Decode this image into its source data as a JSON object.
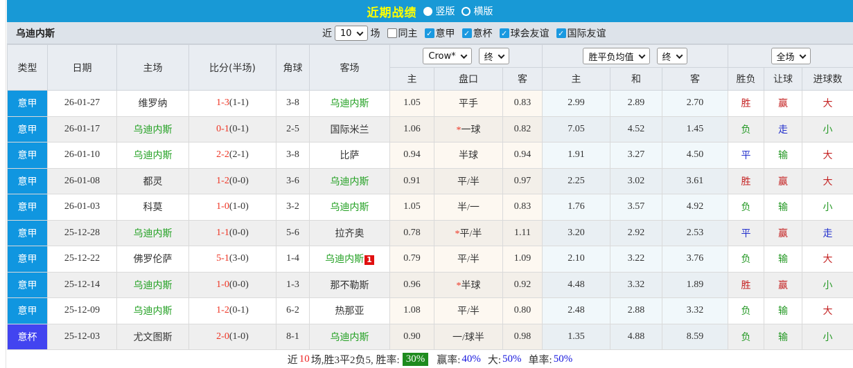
{
  "topbar": {
    "title": "近期战绩",
    "view_options": [
      {
        "label": "竖版",
        "selected": true
      },
      {
        "label": "横版",
        "selected": false
      }
    ]
  },
  "filterbar": {
    "team": "乌迪内斯",
    "recent_label": "近",
    "recent_value": "10",
    "recent_suffix": "场",
    "checkboxes": [
      {
        "label": "同主",
        "checked": false
      },
      {
        "label": "意甲",
        "checked": true
      },
      {
        "label": "意杯",
        "checked": true
      },
      {
        "label": "球会友谊",
        "checked": true
      },
      {
        "label": "国际友谊",
        "checked": true
      }
    ]
  },
  "table": {
    "columns": [
      "类型",
      "日期",
      "主场",
      "比分(半场)",
      "角球",
      "客场"
    ],
    "odds_group": {
      "selects": [
        "Crow*",
        "终"
      ],
      "subcolumns": [
        "主",
        "盘口",
        "客"
      ]
    },
    "avg_group": {
      "selects": [
        "胜平负均值",
        "终"
      ],
      "subcolumns": [
        "主",
        "和",
        "客"
      ]
    },
    "result_group": {
      "selects": [
        "全场"
      ],
      "subcolumns": [
        "胜负",
        "让球",
        "进球数"
      ]
    },
    "rows": [
      {
        "league": "意甲",
        "league_color": "blue",
        "date": "26-01-27",
        "home": "维罗纳",
        "home_highlight": false,
        "home_badge": "",
        "score": "1-3",
        "half": "(1-1)",
        "corners": "3-8",
        "away": "乌迪内斯",
        "away_highlight": true,
        "away_badge": "",
        "odds_home": "1.05",
        "handicap_star": false,
        "handicap": "平手",
        "odds_away": "0.83",
        "avg_home": "2.99",
        "avg_draw": "2.89",
        "avg_away": "2.70",
        "result": "胜",
        "result_color": "red",
        "handicap_result": "赢",
        "handicap_result_color": "red",
        "goals": "大",
        "goals_color": "red"
      },
      {
        "league": "意甲",
        "league_color": "blue",
        "date": "26-01-17",
        "home": "乌迪内斯",
        "home_highlight": true,
        "home_badge": "",
        "score": "0-1",
        "half": "(0-1)",
        "corners": "2-5",
        "away": "国际米兰",
        "away_highlight": false,
        "away_badge": "",
        "odds_home": "1.06",
        "handicap_star": true,
        "handicap": "一球",
        "odds_away": "0.82",
        "avg_home": "7.05",
        "avg_draw": "4.52",
        "avg_away": "1.45",
        "result": "负",
        "result_color": "green",
        "handicap_result": "走",
        "handicap_result_color": "blue",
        "goals": "小",
        "goals_color": "green"
      },
      {
        "league": "意甲",
        "league_color": "blue",
        "date": "26-01-10",
        "home": "乌迪内斯",
        "home_highlight": true,
        "home_badge": "",
        "score": "2-2",
        "half": "(2-1)",
        "corners": "3-8",
        "away": "比萨",
        "away_highlight": false,
        "away_badge": "",
        "odds_home": "0.94",
        "handicap_star": false,
        "handicap": "半球",
        "odds_away": "0.94",
        "avg_home": "1.91",
        "avg_draw": "3.27",
        "avg_away": "4.50",
        "result": "平",
        "result_color": "blue",
        "handicap_result": "输",
        "handicap_result_color": "green",
        "goals": "大",
        "goals_color": "red"
      },
      {
        "league": "意甲",
        "league_color": "blue",
        "date": "26-01-08",
        "home": "都灵",
        "home_highlight": false,
        "home_badge": "",
        "score": "1-2",
        "half": "(0-0)",
        "corners": "3-6",
        "away": "乌迪内斯",
        "away_highlight": true,
        "away_badge": "",
        "odds_home": "0.91",
        "handicap_star": false,
        "handicap": "平/半",
        "odds_away": "0.97",
        "avg_home": "2.25",
        "avg_draw": "3.02",
        "avg_away": "3.61",
        "result": "胜",
        "result_color": "red",
        "handicap_result": "赢",
        "handicap_result_color": "red",
        "goals": "大",
        "goals_color": "red"
      },
      {
        "league": "意甲",
        "league_color": "blue",
        "date": "26-01-03",
        "home": "科莫",
        "home_highlight": false,
        "home_badge": "",
        "score": "1-0",
        "half": "(1-0)",
        "corners": "3-2",
        "away": "乌迪内斯",
        "away_highlight": true,
        "away_badge": "",
        "odds_home": "1.05",
        "handicap_star": false,
        "handicap": "半/一",
        "odds_away": "0.83",
        "avg_home": "1.76",
        "avg_draw": "3.57",
        "avg_away": "4.92",
        "result": "负",
        "result_color": "green",
        "handicap_result": "输",
        "handicap_result_color": "green",
        "goals": "小",
        "goals_color": "green"
      },
      {
        "league": "意甲",
        "league_color": "blue",
        "date": "25-12-28",
        "home": "乌迪内斯",
        "home_highlight": true,
        "home_badge": "",
        "score": "1-1",
        "half": "(0-0)",
        "corners": "5-6",
        "away": "拉齐奥",
        "away_highlight": false,
        "away_badge": "",
        "odds_home": "0.78",
        "handicap_star": true,
        "handicap": "平/半",
        "odds_away": "1.11",
        "avg_home": "3.20",
        "avg_draw": "2.92",
        "avg_away": "2.53",
        "result": "平",
        "result_color": "blue",
        "handicap_result": "赢",
        "handicap_result_color": "red",
        "goals": "走",
        "goals_color": "blue"
      },
      {
        "league": "意甲",
        "league_color": "blue",
        "date": "25-12-22",
        "home": "佛罗伦萨",
        "home_highlight": false,
        "home_badge": "",
        "score": "5-1",
        "half": "(3-0)",
        "corners": "1-4",
        "away": "乌迪内斯",
        "away_highlight": true,
        "away_badge": "1",
        "odds_home": "0.79",
        "handicap_star": false,
        "handicap": "平/半",
        "odds_away": "1.09",
        "avg_home": "2.10",
        "avg_draw": "3.22",
        "avg_away": "3.76",
        "result": "负",
        "result_color": "green",
        "handicap_result": "输",
        "handicap_result_color": "green",
        "goals": "大",
        "goals_color": "red"
      },
      {
        "league": "意甲",
        "league_color": "blue",
        "date": "25-12-14",
        "home": "乌迪内斯",
        "home_highlight": true,
        "home_badge": "",
        "score": "1-0",
        "half": "(0-0)",
        "corners": "1-3",
        "away": "那不勒斯",
        "away_highlight": false,
        "away_badge": "",
        "odds_home": "0.96",
        "handicap_star": true,
        "handicap": "半球",
        "odds_away": "0.92",
        "avg_home": "4.48",
        "avg_draw": "3.32",
        "avg_away": "1.89",
        "result": "胜",
        "result_color": "red",
        "handicap_result": "赢",
        "handicap_result_color": "red",
        "goals": "小",
        "goals_color": "green"
      },
      {
        "league": "意甲",
        "league_color": "blue",
        "date": "25-12-09",
        "home": "乌迪内斯",
        "home_highlight": true,
        "home_badge": "",
        "score": "1-2",
        "half": "(0-1)",
        "corners": "6-2",
        "away": "热那亚",
        "away_highlight": false,
        "away_badge": "",
        "odds_home": "1.08",
        "handicap_star": false,
        "handicap": "平/半",
        "odds_away": "0.80",
        "avg_home": "2.48",
        "avg_draw": "2.88",
        "avg_away": "3.32",
        "result": "负",
        "result_color": "green",
        "handicap_result": "输",
        "handicap_result_color": "green",
        "goals": "大",
        "goals_color": "red"
      },
      {
        "league": "意杯",
        "league_color": "indigo",
        "date": "25-12-03",
        "home": "尤文图斯",
        "home_highlight": false,
        "home_badge": "",
        "score": "2-0",
        "half": "(1-0)",
        "corners": "8-1",
        "away": "乌迪内斯",
        "away_highlight": true,
        "away_badge": "",
        "odds_home": "0.90",
        "handicap_star": false,
        "handicap": "一/球半",
        "odds_away": "0.98",
        "avg_home": "1.35",
        "avg_draw": "4.88",
        "avg_away": "8.59",
        "result": "负",
        "result_color": "green",
        "handicap_result": "输",
        "handicap_result_color": "green",
        "goals": "小",
        "goals_color": "green"
      }
    ]
  },
  "footer": {
    "prefix": "近",
    "count": "10",
    "summary": "场,胜3平2负5, 胜率:",
    "win_rate": "30%",
    "seg2_label": "赢率:",
    "seg2_value": "40%",
    "seg3_label": "大:",
    "seg3_value": "50%",
    "seg4_label": "单率:",
    "seg4_value": "50%"
  },
  "colors": {
    "topbar_blue": "#1899d6",
    "title_yellow": "#ffff00",
    "serie_a_badge": "#1096e0",
    "coppa_badge": "#4244f0",
    "team_green": "#22a022",
    "score_red": "#ee3322",
    "result_red": "#c42222",
    "result_green": "#259925",
    "result_blue": "#2330cc",
    "win_rate_bg": "#1e8b1e",
    "footer_value_blue": "#1515dd"
  }
}
